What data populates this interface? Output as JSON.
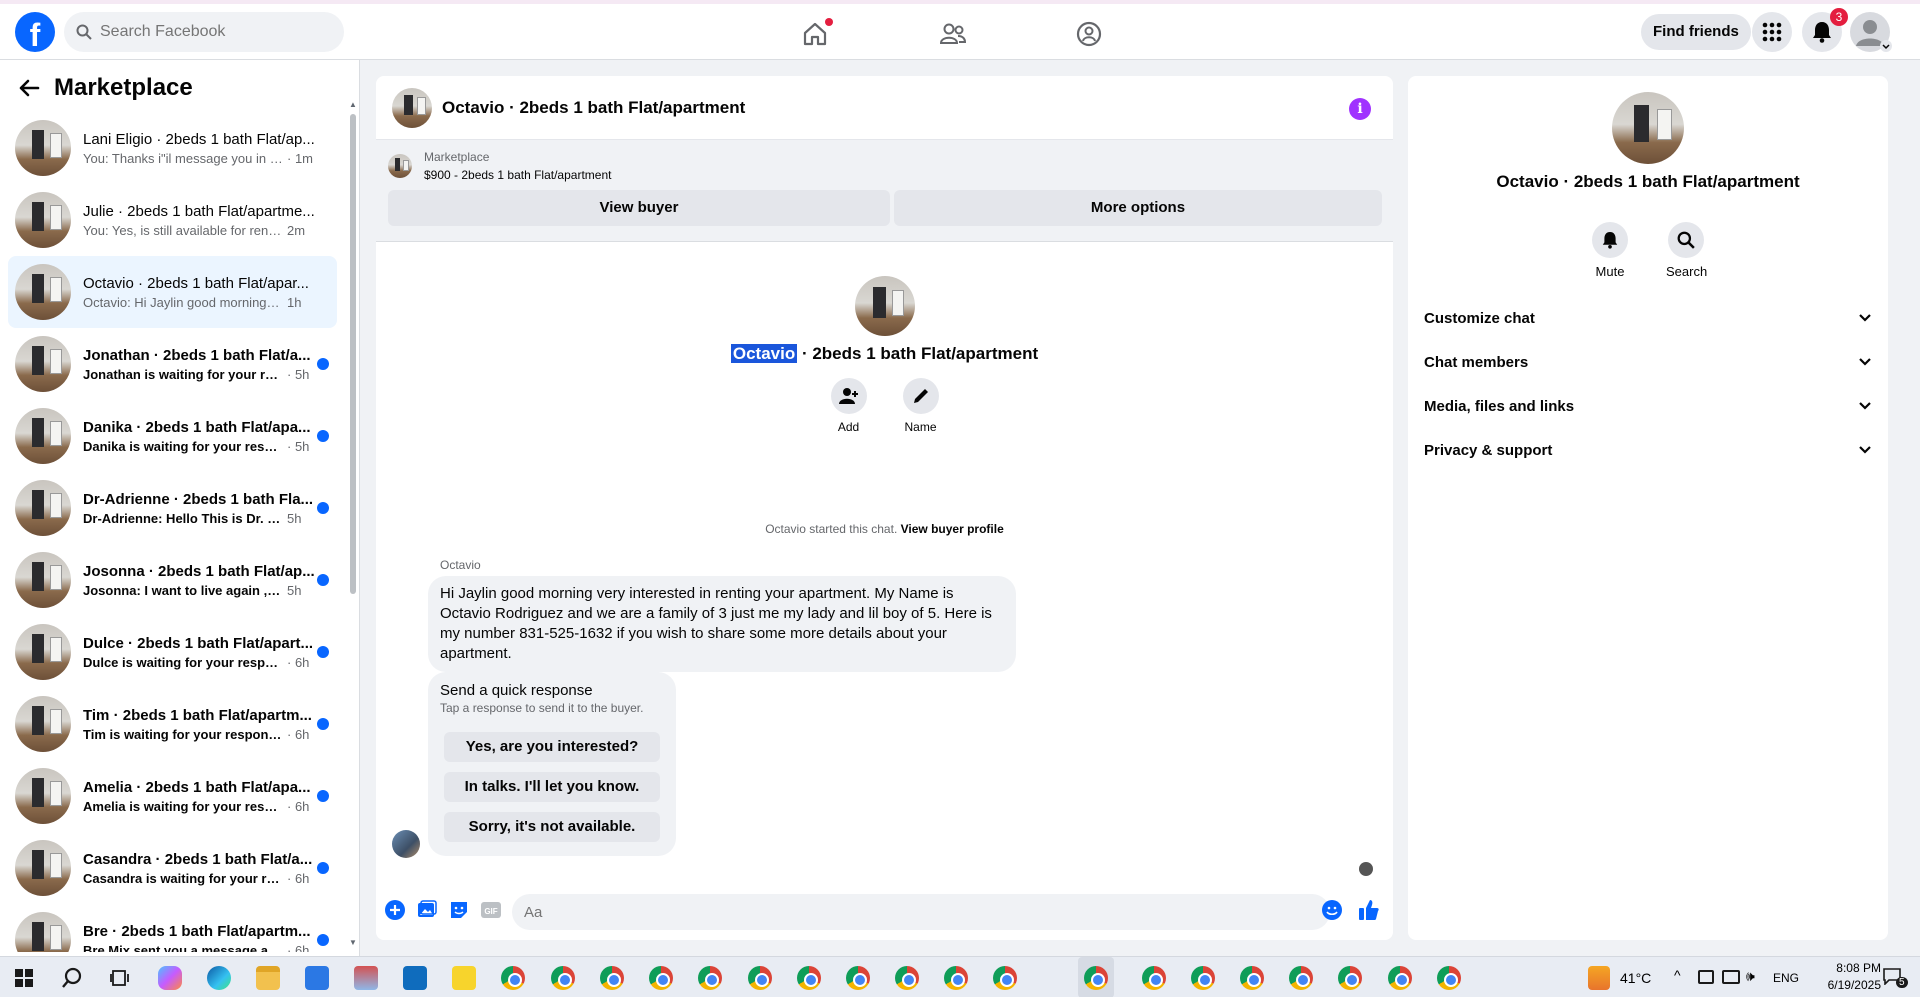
{
  "topbar": {
    "search_placeholder": "Search Facebook",
    "find_friends": "Find friends",
    "notifications_count": "3"
  },
  "sidebar": {
    "title": "Marketplace",
    "conversations": [
      {
        "title": "Lani Eligio · 2beds 1 bath Flat/ap...",
        "snippet": "You: Thanks i\"il message you in a ...",
        "time": "· 1m",
        "unread": false
      },
      {
        "title": "Julie · 2beds 1 bath Flat/apartme...",
        "snippet": "You: Yes, is still available for rent. P...",
        "time": "2m",
        "unread": false
      },
      {
        "title": "Octavio · 2beds 1 bath Flat/apar...",
        "snippet": "Octavio: Hi Jaylin good morning ve...",
        "time": "1h",
        "unread": false,
        "active": true
      },
      {
        "title": "Jonathan · 2beds 1 bath Flat/a...",
        "snippet": "Jonathan is waiting for your res...",
        "time": "· 5h",
        "unread": true
      },
      {
        "title": "Danika · 2beds 1 bath Flat/apa...",
        "snippet": "Danika is waiting for your respo...",
        "time": "· 5h",
        "unread": true
      },
      {
        "title": "Dr-Adrienne · 2beds 1 bath Fla...",
        "snippet": "Dr-Adrienne: Hello This is Dr. Lar...",
        "time": "5h",
        "unread": true
      },
      {
        "title": "Josonna · 2beds 1 bath Flat/ap...",
        "snippet": "Josonna: I want to live again , w...",
        "time": "5h",
        "unread": true
      },
      {
        "title": "Dulce · 2beds 1 bath Flat/apart...",
        "snippet": "Dulce is waiting for your respon...",
        "time": "· 6h",
        "unread": true
      },
      {
        "title": "Tim · 2beds 1 bath Flat/apartm...",
        "snippet": "Tim is waiting for your response.",
        "time": "· 6h",
        "unread": true
      },
      {
        "title": "Amelia · 2beds 1 bath Flat/apa...",
        "snippet": "Amelia is waiting for your respo...",
        "time": "· 6h",
        "unread": true
      },
      {
        "title": "Casandra · 2beds 1 bath Flat/a...",
        "snippet": "Casandra is waiting for your res...",
        "time": "· 6h",
        "unread": true
      },
      {
        "title": "Bre · 2beds 1 bath Flat/apartm...",
        "snippet": "Bre Mix sent you a message abo...",
        "time": "· 6h",
        "unread": true
      }
    ]
  },
  "chat": {
    "header_title": "Octavio · 2beds 1 bath Flat/apartment",
    "marketplace_label": "Marketplace",
    "listing": "$900 - 2beds 1 bath Flat/apartment",
    "view_buyer": "View buyer",
    "more_options": "More options",
    "profile_name_highlight": "Octavio",
    "profile_name_rest": " · 2beds 1 bath Flat/apartment",
    "add_label": "Add",
    "name_label": "Name",
    "started_text": "Octavio started this chat. ",
    "view_buyer_profile": "View buyer profile",
    "sender": "Octavio",
    "message": "Hi Jaylin good morning very interested in renting your apartment. My Name is Octavio Rodriguez and we are a family of 3  just me my lady and lil boy of 5. Here is my number 831-525-1632 if you wish to share some more details about your apartment.",
    "quick_title": "Send a quick response",
    "quick_sub": "Tap a response to send it to the buyer.",
    "quick_responses": [
      "Yes, are you interested?",
      "In talks. I'll let you know.",
      "Sorry, it's not available."
    ],
    "composer_placeholder": "Aa"
  },
  "rightpanel": {
    "name": "Octavio · 2beds 1 bath Flat/apartment",
    "mute": "Mute",
    "search": "Search",
    "sections": [
      "Customize chat",
      "Chat members",
      "Media, files and links",
      "Privacy & support"
    ]
  },
  "taskbar": {
    "weather": "41°C",
    "language": "ENG",
    "time": "8:08 PM",
    "date": "6/19/2025",
    "notif": "5"
  },
  "colors": {
    "facebook_blue": "#0866ff",
    "unread_dot": "#0866ff",
    "badge_red": "#e41e3f",
    "info_purple": "#a033ff",
    "active_conv": "#ebf5ff"
  }
}
